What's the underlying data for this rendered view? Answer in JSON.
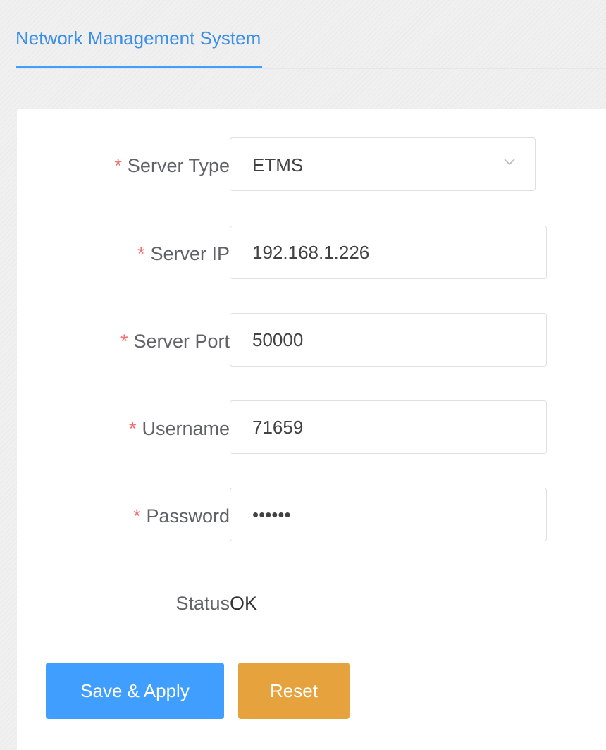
{
  "tabs": [
    {
      "label": "Network Management System",
      "active": true
    }
  ],
  "form": {
    "required_mark": "*",
    "server_type": {
      "label": "Server Type",
      "value": "ETMS",
      "icon": "chevron-down-icon"
    },
    "server_ip": {
      "label": "Server IP",
      "value": "192.168.1.226"
    },
    "server_port": {
      "label": "Server Port",
      "value": "50000"
    },
    "username": {
      "label": "Username",
      "value": "71659"
    },
    "password": {
      "label": "Password",
      "value": "••••••"
    },
    "status": {
      "label": "Status",
      "value": "OK"
    }
  },
  "actions": {
    "save_label": "Save & Apply",
    "reset_label": "Reset"
  },
  "colors": {
    "accent": "#409eff",
    "warning": "#e6a23c",
    "required": "#f56c6c"
  }
}
